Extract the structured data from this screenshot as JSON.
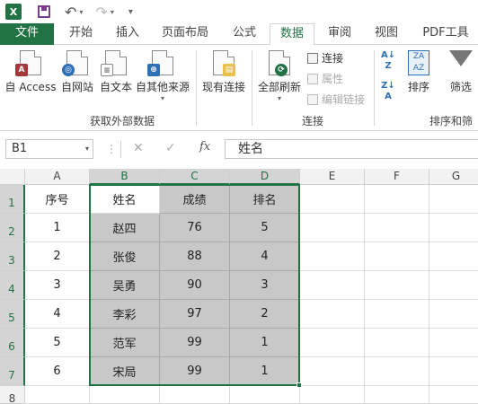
{
  "qat": {
    "app_icon": "X",
    "save_icon": "save-icon",
    "undo_icon": "↶",
    "redo_icon": "↷",
    "more_icon": "▾"
  },
  "tabs": [
    {
      "label": "文件"
    },
    {
      "label": "开始"
    },
    {
      "label": "插入"
    },
    {
      "label": "页面布局"
    },
    {
      "label": "公式"
    },
    {
      "label": "数据"
    },
    {
      "label": "审阅"
    },
    {
      "label": "视图"
    },
    {
      "label": "PDF工具"
    }
  ],
  "ribbon": {
    "btn_access": "自 Access",
    "btn_web": "自网站",
    "btn_text": "自文本",
    "btn_other": "自其他来源",
    "btn_existing": "现有连接",
    "group_external": "获取外部数据",
    "btn_refresh_all": "全部刷新",
    "link_connections": "连接",
    "link_properties": "属性",
    "link_edit_links": "编辑链接",
    "group_connections": "连接",
    "btn_sort": "排序",
    "btn_filter": "筛选",
    "group_sort_filter": "排序和筛"
  },
  "formula_bar": {
    "name_box": "B1",
    "dots": "⋮",
    "cancel": "✕",
    "enter": "✓",
    "fx": "fx",
    "value": "姓名"
  },
  "columns": [
    "A",
    "B",
    "C",
    "D",
    "E",
    "F",
    "G"
  ],
  "rows": [
    "1",
    "2",
    "3",
    "4",
    "5",
    "6",
    "7",
    "8"
  ],
  "table": {
    "headers": [
      "序号",
      "姓名",
      "成绩",
      "排名"
    ],
    "rows": [
      [
        "1",
        "赵四",
        "76",
        "5"
      ],
      [
        "2",
        "张俊",
        "88",
        "4"
      ],
      [
        "3",
        "吴勇",
        "90",
        "3"
      ],
      [
        "4",
        "李彩",
        "97",
        "2"
      ],
      [
        "5",
        "范军",
        "99",
        "1"
      ],
      [
        "6",
        "宋局",
        "99",
        "1"
      ]
    ]
  },
  "colors": {
    "accent": "#217346",
    "selection_fill": "#c8c8c8"
  }
}
